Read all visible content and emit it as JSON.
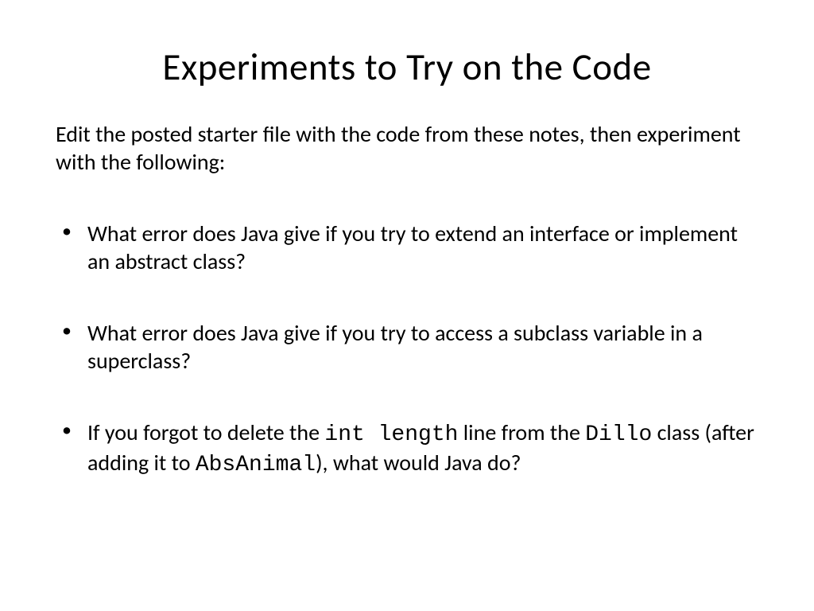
{
  "title": "Experiments to Try on the Code",
  "intro": "Edit the posted starter file with the code from these notes, then experiment with the following:",
  "bullets": [
    {
      "text": "What error does Java give if you try to extend an interface or implement an abstract class?"
    },
    {
      "text": "What error does Java give if you try to access a subclass variable in a superclass?"
    },
    {
      "prefix": "If you forgot to delete the ",
      "code1": "int length",
      "mid1": " line from the ",
      "code2": "Dillo",
      "mid2": " class (after adding it to ",
      "code3": "AbsAnimal",
      "suffix": "), what would Java do?"
    }
  ]
}
